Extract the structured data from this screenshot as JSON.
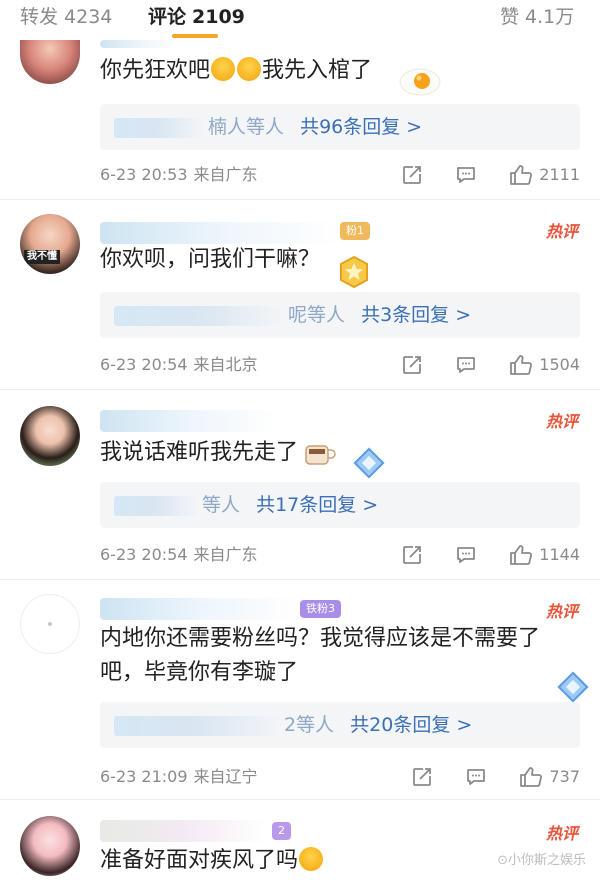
{
  "topbar": {
    "repost": {
      "label": "转发",
      "count": "4234"
    },
    "comments": {
      "label": "评论",
      "count": "2109"
    },
    "likes": {
      "label": "赞",
      "count": "4.1万"
    }
  },
  "colors": {
    "accent": "#f5a623",
    "link": "#3b6fb6",
    "hot": "#e8553a",
    "meta": "#8a8a8a"
  },
  "comments": [
    {
      "text": "你先狂欢吧",
      "text_after_emoji": "我先入棺了",
      "emoji": "laugh-tears-emoji",
      "reply_suffix": "楠人等人",
      "reply_count": "共96条回复 >",
      "time": "6-23 20:53",
      "source": "来自广东",
      "likes": "2111",
      "hot": ""
    },
    {
      "text": "你欢呗，问我们干嘛？",
      "fan_badge": "粉1",
      "reply_suffix": "呢等人",
      "reply_count": "共3条回复 >",
      "time": "6-23 20:54",
      "source": "来自北京",
      "likes": "1504",
      "hot": "热评",
      "avatar_caption": "我不懂"
    },
    {
      "text": "我说话难听我先走了",
      "reply_suffix": "等人",
      "reply_count": "共17条回复 >",
      "time": "6-23 20:54",
      "source": "来自广东",
      "likes": "1144",
      "hot": "热评"
    },
    {
      "text_line1": "内地你还需要粉丝吗？我觉得应该是不需要了",
      "text_line2": "吧，毕竟你有李璇了",
      "fan_badge": "铁粉3",
      "reply_suffix": "2等人",
      "reply_count": "共20条回复 >",
      "time": "6-23 21:09",
      "source": "来自辽宁",
      "likes": "737",
      "hot": "热评"
    },
    {
      "text": "准备好面对疾风了吗",
      "fan_badge": "2",
      "hot": "热评"
    }
  ],
  "watermark": "⊙小你斯之娱乐"
}
